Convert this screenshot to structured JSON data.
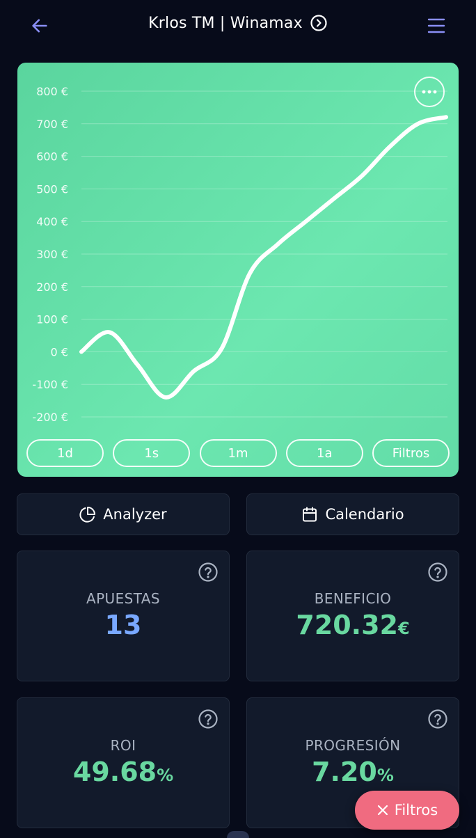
{
  "header": {
    "title": "Krlos TM | Winamax"
  },
  "colors": {
    "background": "#070b1a",
    "accent": "#8a8ff5",
    "card": "#121a2b",
    "chart_bg": "#63dda7",
    "positive": "#69d8a0",
    "count": "#79a8ff",
    "fab": "#f06b80"
  },
  "chart_data": {
    "type": "line",
    "title": "",
    "xlabel": "",
    "ylabel": "",
    "ylim": [
      -200,
      800
    ],
    "yticks": [
      800,
      700,
      600,
      500,
      400,
      300,
      200,
      100,
      0,
      -100,
      -200
    ],
    "ytick_labels": [
      "800 €",
      "700 €",
      "600 €",
      "500 €",
      "400 €",
      "300 €",
      "200 €",
      "100 €",
      "0 €",
      "-100 €",
      "-200 €"
    ],
    "grid": true,
    "x": [
      0,
      1,
      2,
      3,
      4,
      5,
      6,
      7,
      8,
      9,
      10,
      11,
      12,
      13
    ],
    "values": [
      0,
      60,
      -40,
      -140,
      -60,
      10,
      240,
      330,
      400,
      470,
      540,
      630,
      700,
      720.32
    ],
    "line_color": "#ffffff"
  },
  "range_buttons": [
    "1d",
    "1s",
    "1m",
    "1a",
    "Filtros"
  ],
  "actions": {
    "analyzer": "Analyzer",
    "calendario": "Calendario"
  },
  "stats": {
    "apuestas": {
      "label": "APUESTAS",
      "value": "13"
    },
    "beneficio": {
      "label": "BENEFICIO",
      "value": "720.32",
      "unit": "€"
    },
    "roi": {
      "label": "ROI",
      "value": "49.68",
      "unit": "%"
    },
    "progresion": {
      "label": "PROGRESIÓN",
      "value": "7.20",
      "unit": "%"
    }
  },
  "fab": {
    "label": "Filtros"
  },
  "icons": {
    "back": "arrow-left-icon",
    "title_chevron": "chevron-right-circle-icon",
    "menu": "hamburger-menu-icon",
    "more": "more-horizontal-icon",
    "analyzer": "pie-chart-icon",
    "calendario": "calendar-icon",
    "help": "question-circle-icon",
    "fab": "close-icon"
  }
}
